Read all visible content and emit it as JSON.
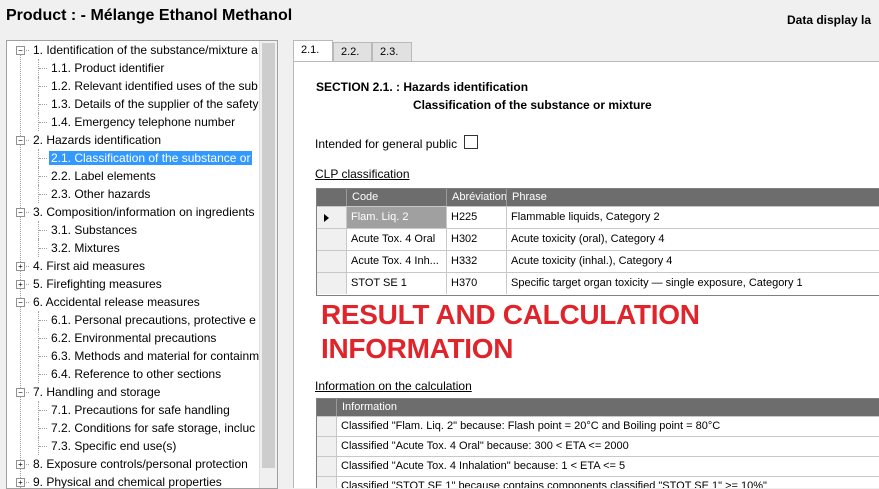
{
  "header": {
    "product_title": "Product :  - Mélange Ethanol Methanol",
    "data_display": "Data display la"
  },
  "tree": {
    "items": [
      {
        "label": "1. Identification of the substance/mixture a",
        "level": 0,
        "expander": "minus"
      },
      {
        "label": "1.1. Product identifier",
        "level": 1
      },
      {
        "label": "1.2. Relevant identified uses of the sub",
        "level": 1
      },
      {
        "label": "1.3. Details of the supplier of the safety",
        "level": 1
      },
      {
        "label": "1.4. Emergency telephone number",
        "level": 1
      },
      {
        "label": "2. Hazards identification",
        "level": 0,
        "expander": "minus"
      },
      {
        "label": "2.1. Classification of the substance or",
        "level": 1,
        "selected": true
      },
      {
        "label": "2.2. Label elements",
        "level": 1
      },
      {
        "label": "2.3. Other hazards",
        "level": 1
      },
      {
        "label": "3. Composition/information on ingredients",
        "level": 0,
        "expander": "minus"
      },
      {
        "label": "3.1. Substances",
        "level": 1
      },
      {
        "label": "3.2. Mixtures",
        "level": 1
      },
      {
        "label": "4. First aid measures",
        "level": 0,
        "expander": "plus"
      },
      {
        "label": "5. Firefighting measures",
        "level": 0,
        "expander": "plus"
      },
      {
        "label": "6. Accidental release measures",
        "level": 0,
        "expander": "minus"
      },
      {
        "label": "6.1. Personal precautions, protective e",
        "level": 1
      },
      {
        "label": "6.2. Environmental precautions",
        "level": 1
      },
      {
        "label": "6.3. Methods and material for containm",
        "level": 1
      },
      {
        "label": "6.4. Reference to other sections",
        "level": 1
      },
      {
        "label": "7. Handling and storage",
        "level": 0,
        "expander": "minus"
      },
      {
        "label": "7.1. Precautions for safe handling",
        "level": 1
      },
      {
        "label": "7.2. Conditions for safe storage, incluc",
        "level": 1
      },
      {
        "label": "7.3. Specific end use(s)",
        "level": 1
      },
      {
        "label": "8. Exposure controls/personal protection",
        "level": 0,
        "expander": "plus"
      },
      {
        "label": "9. Physical and chemical properties",
        "level": 0,
        "expander": "plus"
      }
    ]
  },
  "tabs": [
    {
      "label": "2.1.",
      "active": true
    },
    {
      "label": "2.2.",
      "active": false
    },
    {
      "label": "2.3.",
      "active": false
    }
  ],
  "section": {
    "title": "SECTION 2.1. : Hazards identification",
    "subtitle": "Classification of the substance or mixture",
    "general_public_label": "Intended for general public",
    "general_public_checked": false
  },
  "clp": {
    "heading": "CLP classification",
    "columns": [
      "Code",
      "Abréviation",
      "Phrase"
    ],
    "rows": [
      {
        "code": "Flam. Liq. 2",
        "abbr": "H225",
        "phrase": "Flammable liquids, Category 2",
        "current": true
      },
      {
        "code": "Acute Tox. 4 Oral",
        "abbr": "H302",
        "phrase": "Acute toxicity (oral), Category 4"
      },
      {
        "code": "Acute Tox. 4 Inh...",
        "abbr": "H332",
        "phrase": "Acute toxicity (inhal.), Category 4"
      },
      {
        "code": "STOT SE 1",
        "abbr": "H370",
        "phrase": "Specific target organ toxicity — single exposure, Category 1"
      }
    ]
  },
  "overlay": {
    "line1": "RESULT AND CALCULATION",
    "line2": "INFORMATION",
    "color": "#e0242b"
  },
  "calculation": {
    "heading": "Information on the calculation",
    "columns": [
      "Information"
    ],
    "rows": [
      "Classified \"Flam. Liq. 2\" because: Flash point = 20°C and Boiling point = 80°C",
      "Classified \"Acute Tox. 4 Oral\" because: 300 < ETA <= 2000",
      "Classified \"Acute Tox. 4 Inhalation\" because: 1 < ETA <= 5",
      "Classified \"STOT SE 1\" because contains components classified \"STOT SE 1\" >= 10%\""
    ]
  },
  "colors": {
    "selection": "#3399ff",
    "grid_header": "#6d6d6d",
    "selected_cell": "#a0a0a0"
  }
}
